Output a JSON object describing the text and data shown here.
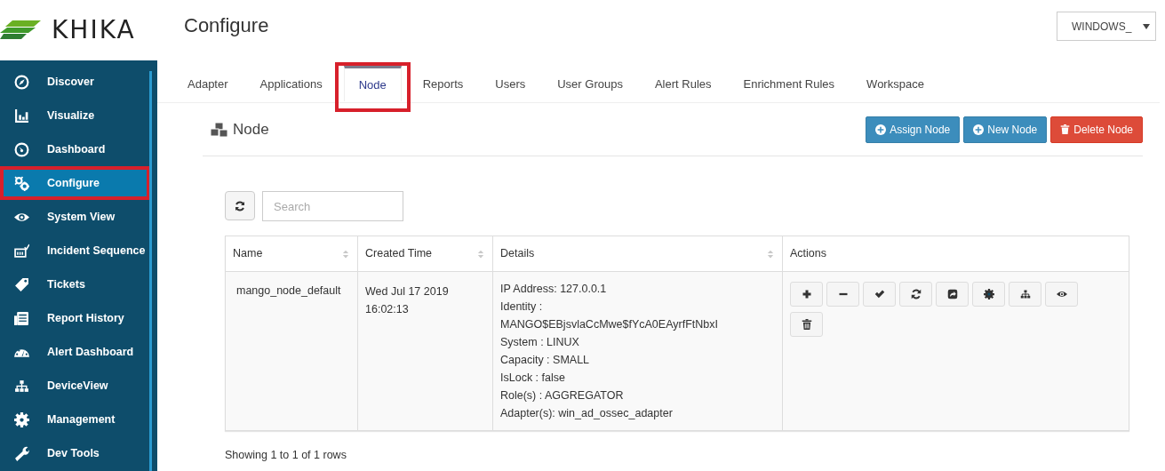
{
  "logo": {
    "text": "KHIKA"
  },
  "sidebar": {
    "items": [
      {
        "label": "Discover",
        "selected": false,
        "highlighted": false
      },
      {
        "label": "Visualize",
        "selected": false,
        "highlighted": false
      },
      {
        "label": "Dashboard",
        "selected": false,
        "highlighted": false
      },
      {
        "label": "Configure",
        "selected": true,
        "highlighted": true
      },
      {
        "label": "System View",
        "selected": false,
        "highlighted": false
      },
      {
        "label": "Incident Sequence",
        "selected": false,
        "highlighted": false
      },
      {
        "label": "Tickets",
        "selected": false,
        "highlighted": false
      },
      {
        "label": "Report History",
        "selected": false,
        "highlighted": false
      },
      {
        "label": "Alert Dashboard",
        "selected": false,
        "highlighted": false
      },
      {
        "label": "DeviceView",
        "selected": false,
        "highlighted": false
      },
      {
        "label": "Management",
        "selected": false,
        "highlighted": false
      },
      {
        "label": "Dev Tools",
        "selected": false,
        "highlighted": false
      }
    ]
  },
  "header": {
    "title": "Configure",
    "workspace_select": {
      "value": "WINDOWS_"
    }
  },
  "tabs": [
    {
      "label": "Adapter",
      "selected": false,
      "highlighted": false
    },
    {
      "label": "Applications",
      "selected": false,
      "highlighted": false
    },
    {
      "label": "Node",
      "selected": true,
      "highlighted": true
    },
    {
      "label": "Reports",
      "selected": false,
      "highlighted": false
    },
    {
      "label": "Users",
      "selected": false,
      "highlighted": false
    },
    {
      "label": "User Groups",
      "selected": false,
      "highlighted": false
    },
    {
      "label": "Alert Rules",
      "selected": false,
      "highlighted": false
    },
    {
      "label": "Enrichment Rules",
      "selected": false,
      "highlighted": false
    },
    {
      "label": "Workspace",
      "selected": false,
      "highlighted": false
    }
  ],
  "section": {
    "title": "Node",
    "buttons": [
      {
        "label": "Assign Node",
        "kind": "primary"
      },
      {
        "label": "New Node",
        "kind": "primary"
      },
      {
        "label": "Delete Node",
        "kind": "danger"
      }
    ]
  },
  "search": {
    "placeholder": "Search"
  },
  "table": {
    "columns": [
      {
        "label": "Name",
        "sortable": true
      },
      {
        "label": "Created Time",
        "sortable": true
      },
      {
        "label": "Details",
        "sortable": true
      },
      {
        "label": "Actions",
        "sortable": false
      }
    ],
    "rows": [
      {
        "name": "mango_node_default",
        "created_time": [
          "Wed Jul 17 2019",
          "16:02:13"
        ],
        "details": [
          "IP Address: 127.0.0.1",
          "Identity :",
          "MANGO$EBjsvlaCcMwe$fYcA0EAyrfFtNbxI",
          "System : LINUX",
          "Capacity : SMALL",
          "IsLock : false",
          "Role(s) : AGGREGATOR",
          "Adapter(s): win_ad_ossec_adapter"
        ]
      }
    ]
  },
  "footer": {
    "text": "Showing 1 to 1 of 1 rows"
  }
}
